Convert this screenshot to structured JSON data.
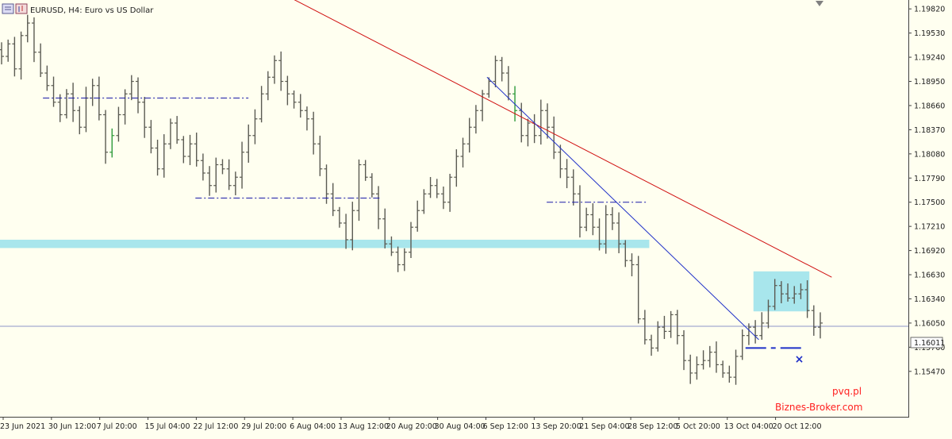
{
  "header": {
    "title": "EURUSD, H4:  Euro vs US Dollar",
    "icon": "chart-window-icon"
  },
  "watermark": {
    "line1": "pvq.pl",
    "line2": "Biznes-Broker.com"
  },
  "colors": {
    "background": "#fffff0",
    "candles": "#5a5a52",
    "bull_highlight": "#2e9a3a",
    "red_trendline": "#d01010",
    "blue_trendline": "#1f30c8",
    "support_dash": "#1a1aa8",
    "zone": "#a8e6ec",
    "price_line": "#8e95c8",
    "watermark_text": "#ff2020",
    "axis": "#404040"
  },
  "chart_data": {
    "type": "candlestick",
    "symbol": "EURUSD",
    "timeframe": "H4",
    "ylim": [
      1.1523,
      1.1986
    ],
    "current_price": "1.16011",
    "y_ticks": [
      "1.19820",
      "1.19530",
      "1.19240",
      "1.18950",
      "1.18660",
      "1.18370",
      "1.18080",
      "1.17790",
      "1.17500",
      "1.17210",
      "1.16920",
      "1.16630",
      "1.16340",
      "1.16050",
      "1.15760",
      "1.15470"
    ],
    "x_ticks": [
      "23 Jun 2021",
      "30 Jun 12:00",
      "7 Jul 20:00",
      "15 Jul 04:00",
      "22 Jul 12:00",
      "29 Jul 20:00",
      "6 Aug 04:00",
      "13 Aug 12:00",
      "20 Aug 20:00",
      "30 Aug 04:00",
      "6 Sep 12:00",
      "13 Sep 20:00",
      "21 Sep 04:00",
      "28 Sep 12:00",
      "5 Oct 20:00",
      "13 Oct 04:00",
      "20 Oct 12:00"
    ],
    "closes": [
      1.1925,
      1.194,
      1.191,
      1.195,
      1.1965,
      1.193,
      1.1905,
      1.189,
      1.187,
      1.1855,
      1.188,
      1.186,
      1.184,
      1.1875,
      1.189,
      1.1855,
      1.181,
      1.183,
      1.1855,
      1.188,
      1.1895,
      1.187,
      1.184,
      1.1815,
      1.179,
      1.182,
      1.1845,
      1.1825,
      1.1805,
      1.182,
      1.18,
      1.1785,
      1.177,
      1.1795,
      1.179,
      1.177,
      1.178,
      1.181,
      1.183,
      1.185,
      1.188,
      1.19,
      1.192,
      1.1895,
      1.188,
      1.187,
      1.186,
      1.185,
      1.182,
      1.179,
      1.176,
      1.174,
      1.1725,
      1.1705,
      1.174,
      1.1795,
      1.178,
      1.176,
      1.173,
      1.17,
      1.169,
      1.1675,
      1.169,
      1.172,
      1.174,
      1.176,
      1.177,
      1.176,
      1.175,
      1.178,
      1.1805,
      1.182,
      1.184,
      1.186,
      1.188,
      1.1895,
      1.192,
      1.1905,
      1.188,
      1.186,
      1.183,
      1.1845,
      1.183,
      1.186,
      1.184,
      1.181,
      1.179,
      1.178,
      1.176,
      1.172,
      1.1735,
      1.172,
      1.17,
      1.1735,
      1.1725,
      1.17,
      1.168,
      1.1675,
      1.161,
      1.1585,
      1.1575,
      1.16,
      1.1595,
      1.1615,
      1.159,
      1.156,
      1.1545,
      1.1555,
      1.156,
      1.157,
      1.1555,
      1.1545,
      1.154,
      1.1565,
      1.159,
      1.16,
      1.159,
      1.1605,
      1.1625,
      1.165,
      1.164,
      1.1635,
      1.164,
      1.1645,
      1.162,
      1.16,
      1.1605
    ],
    "annotations": [
      {
        "name": "red-trendline",
        "kind": "trendline",
        "from": {
          "x": "3 Aug 2021",
          "y": 1.2005
        },
        "to": {
          "x": "26 Oct 2021",
          "y": 1.166
        }
      },
      {
        "name": "blue-trendline",
        "kind": "trendline",
        "from": {
          "x": "4 Sep 2021",
          "y": 1.19
        },
        "to": {
          "x": "15 Oct 2021",
          "y": 1.1585
        }
      },
      {
        "name": "dashdot-level-1",
        "kind": "horizontal",
        "y": 1.1875,
        "from": "29 Jun 2021",
        "to": "30 Jul 2021"
      },
      {
        "name": "dashdot-level-2",
        "kind": "horizontal",
        "y": 1.1755,
        "from": "22 Jul 2021",
        "to": "19 Aug 2021"
      },
      {
        "name": "dashdot-level-3",
        "kind": "horizontal",
        "y": 1.175,
        "from": "13 Sep 2021",
        "to": "28 Sep 2021"
      },
      {
        "name": "support-zone",
        "kind": "band",
        "y": [
          1.1695,
          1.1705
        ],
        "from": "23 Jun 2021",
        "to": "28 Sep 2021"
      },
      {
        "name": "consolidation-zone",
        "kind": "box",
        "y": [
          1.1619,
          1.1667
        ],
        "from": "13 Oct 2021",
        "to": "20 Oct 2021"
      },
      {
        "name": "support-dash",
        "kind": "horizontal",
        "y": 1.1575,
        "from": "13 Oct 2021",
        "to": "22 Oct 2021"
      },
      {
        "name": "target-cross",
        "kind": "marker",
        "symbol": "×",
        "x": "21 Oct 2021",
        "y": 1.1563
      }
    ]
  }
}
